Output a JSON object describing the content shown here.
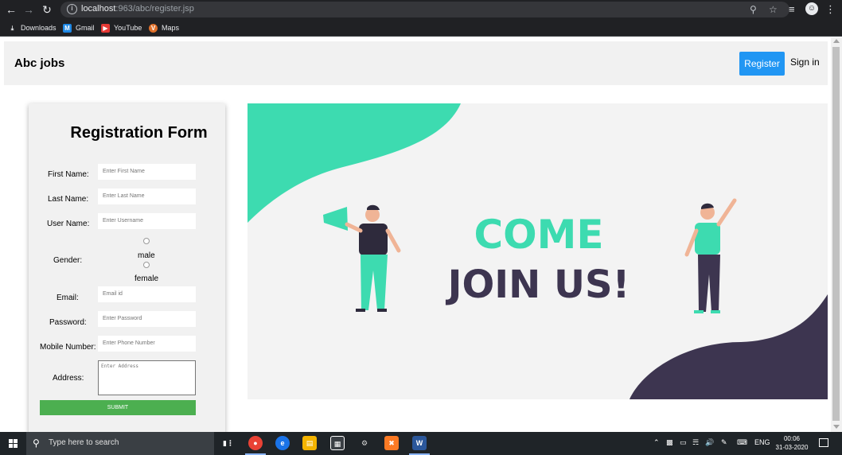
{
  "browser": {
    "url_host": "localhost",
    "url_rest": ":963/abc/register.jsp",
    "bookmarks": [
      {
        "label": "Downloads",
        "icon": "download-icon"
      },
      {
        "label": "Gmail",
        "icon": "gmail-icon"
      },
      {
        "label": "YouTube",
        "icon": "youtube-icon"
      },
      {
        "label": "Maps",
        "icon": "maps-icon"
      }
    ]
  },
  "navbar": {
    "brand": "Abc jobs",
    "register_label": "Register",
    "signin_label": "Sign in",
    "accent": "#2196f3"
  },
  "form": {
    "title": "Registration Form",
    "first_name": {
      "label": "First Name:",
      "placeholder": "Enter First Name"
    },
    "last_name": {
      "label": "Last Name:",
      "placeholder": "Enter Last Name"
    },
    "user_name": {
      "label": "User Name:",
      "placeholder": "Enter Username"
    },
    "gender": {
      "label": "Gender:",
      "options": [
        "male",
        "female"
      ]
    },
    "email": {
      "label": "Email:",
      "placeholder": "Email id"
    },
    "password": {
      "label": "Password:",
      "placeholder": "Enter Password"
    },
    "mobile": {
      "label": "Mobile Number:",
      "placeholder": "Enter Phone Number"
    },
    "address": {
      "label": "Address:",
      "placeholder": "Enter Address"
    },
    "submit_label": "SUBMIT",
    "submit_color": "#4caf50"
  },
  "banner": {
    "line1": "COME",
    "line2": "JOIN US!",
    "accent": "#3ddbb0",
    "dark": "#3d3550"
  },
  "taskbar": {
    "search_placeholder": "Type here to search",
    "language": "ENG",
    "time": "00:06",
    "date": "31-03-2020"
  }
}
